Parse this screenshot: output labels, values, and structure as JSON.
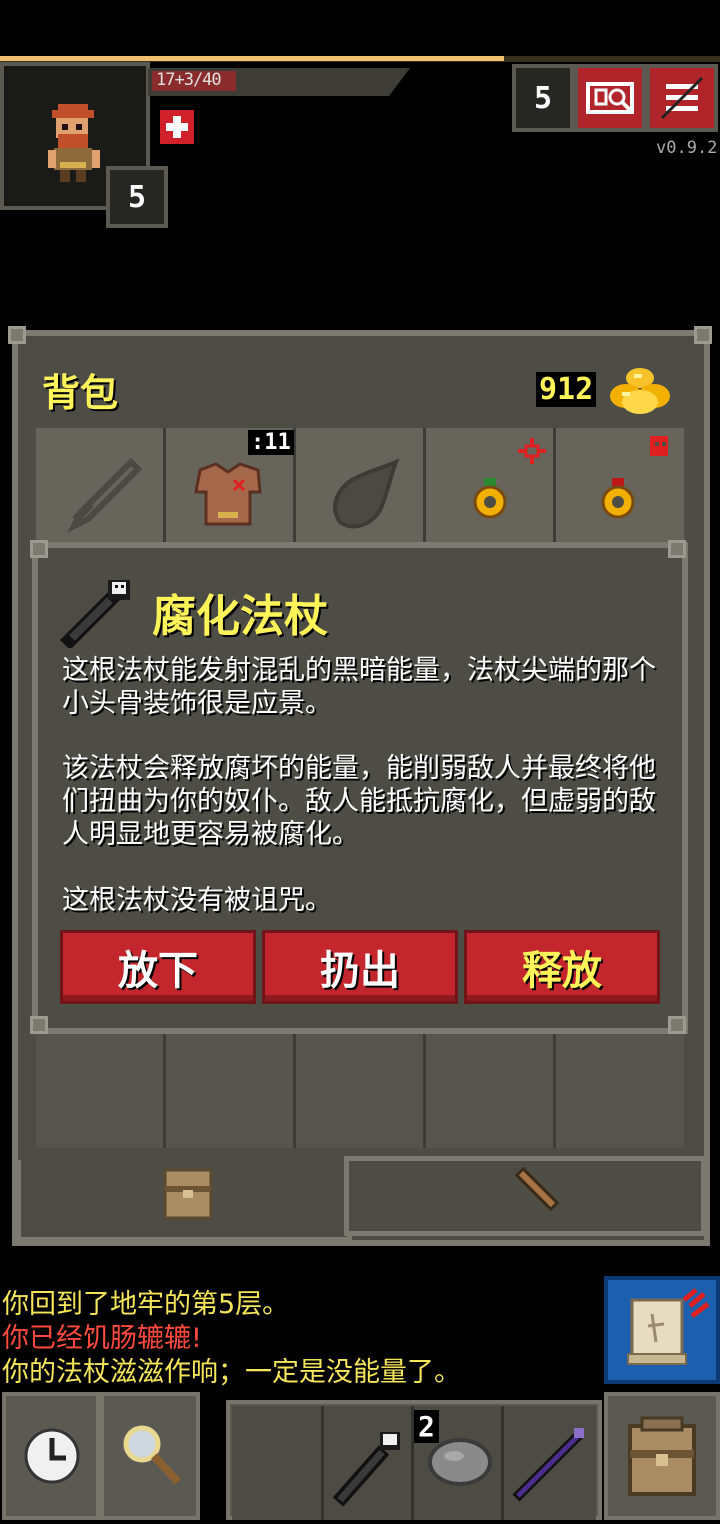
{
  "status": {
    "hp_text": "17+3/40",
    "hero_level": "5",
    "depth": "5",
    "version": "v0.9.2"
  },
  "backpack": {
    "title": "背包",
    "gold": "912",
    "armor_badge": ":11"
  },
  "item": {
    "name": "腐化法杖",
    "desc1": "这根法杖能发射混乱的黑暗能量，法杖尖端的那个小头骨装饰很是应景。",
    "desc2": "该法杖会释放腐坏的能量，能削弱敌人并最终将他们扭曲为你的奴仆。敌人能抵抗腐化，但虚弱的敌人明显地更容易被腐化。",
    "desc3": "这根法杖没有被诅咒。",
    "actions": [
      "放下",
      "扔出",
      "释放"
    ]
  },
  "log": [
    {
      "text": "你回到了地牢的第5层。",
      "color": "#f5e55a"
    },
    {
      "text": "你已经饥肠辘辘!",
      "color": "#ff4b3e"
    },
    {
      "text": "你的法杖滋滋作响；一定是没能量了。",
      "color": "#f5e55a"
    }
  ],
  "quickslot": {
    "stack_count": "2"
  },
  "colors": {
    "title_yellow": "#fff35a",
    "button_red": "#c3272d",
    "panel": "#4e4d45"
  }
}
